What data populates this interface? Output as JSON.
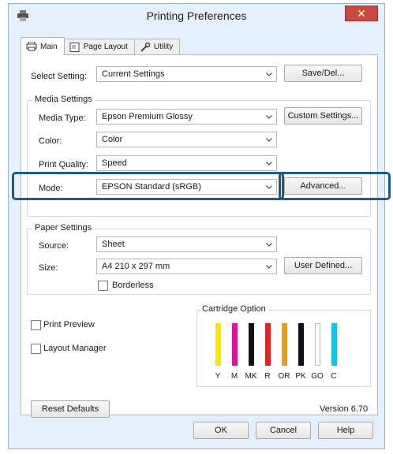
{
  "window": {
    "title": "Printing Preferences",
    "close_glyph": "✕"
  },
  "tabs": [
    {
      "label": "Main",
      "icon": "printer-icon"
    },
    {
      "label": "Page Layout",
      "icon": "page-layout-icon"
    },
    {
      "label": "Utility",
      "icon": "wrench-icon"
    }
  ],
  "select_setting": {
    "label": "Select Setting:",
    "value": "Current Settings",
    "button": "Save/Del..."
  },
  "media": {
    "group_title": "Media Settings",
    "media_type_label": "Media Type:",
    "media_type_value": "Epson Premium Glossy",
    "custom_button": "Custom Settings...",
    "color_label": "Color:",
    "color_value": "Color",
    "quality_label": "Print Quality:",
    "quality_value": "Speed",
    "mode_label": "Mode:",
    "mode_value": "EPSON Standard (sRGB)",
    "advanced_button": "Advanced..."
  },
  "paper": {
    "group_title": "Paper Settings",
    "source_label": "Source:",
    "source_value": "Sheet",
    "size_label": "Size:",
    "size_value": "A4 210 x 297 mm",
    "user_defined_button": "User Defined...",
    "borderless_label": "Borderless"
  },
  "options": {
    "print_preview": "Print Preview",
    "layout_manager": "Layout Manager"
  },
  "cartridge": {
    "title": "Cartridge Option",
    "inks": [
      {
        "code": "Y",
        "color": "#ffe600"
      },
      {
        "code": "M",
        "color": "#e0139c"
      },
      {
        "code": "MK",
        "color": "#111111"
      },
      {
        "code": "R",
        "color": "#e42222"
      },
      {
        "code": "OR",
        "color": "#f39a12"
      },
      {
        "code": "PK",
        "color": "#111111"
      },
      {
        "code": "GO",
        "color": "#ffffff"
      },
      {
        "code": "C",
        "color": "#14c4e8"
      }
    ]
  },
  "footer": {
    "reset_button": "Reset Defaults",
    "version": "Version 6.70"
  },
  "dialog_buttons": {
    "ok": "OK",
    "cancel": "Cancel",
    "help": "Help"
  },
  "colors": {
    "highlight": "#1d5a85",
    "window_bg": "#e4f0fb",
    "close_red": "#c94a3c"
  }
}
